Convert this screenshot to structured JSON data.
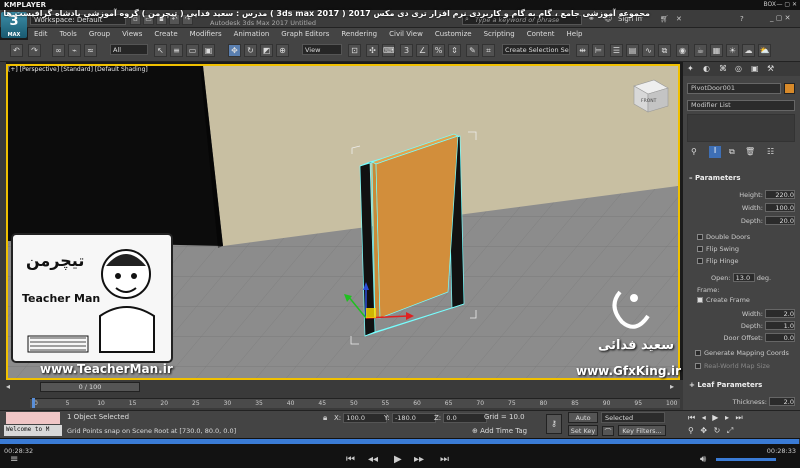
{
  "player": {
    "brand": "KMPLAYER",
    "box_label": "BOX",
    "time_current": "00:28:32",
    "time_total": "00:28:33",
    "progress": 0.999
  },
  "overlay_title": "مجموعه آموزشی جامع ، گام به گام و کاربردی نرم افزار تری دی مکس 2017 ( 3ds max 2017 ) مدرس : سعید فدایی ( تیچرمن ) گروه آموزشی پادشاه گرافیست ها",
  "app": {
    "logo": "3",
    "logo_sub": "MAX",
    "workspace": "Workspace: Default",
    "title": "Autodesk 3ds Max 2017     Untitled",
    "search_placeholder": "Type a keyword or phrase",
    "sign_in": "Sign In"
  },
  "menu": [
    "Edit",
    "Tools",
    "Group",
    "Views",
    "Create",
    "Modifiers",
    "Animation",
    "Graph Editors",
    "Rendering",
    "Civil View",
    "Customize",
    "Scripting",
    "Content",
    "Help"
  ],
  "toolbar": {
    "filter_select": "All",
    "view_select": "View",
    "selection_set": "Create Selection Se"
  },
  "viewport": {
    "label": "[+] [Perspective] [Standard] [Default Shading]",
    "viewcube_label": "FRONT"
  },
  "command_panel": {
    "object_name": "PivotDoor001",
    "modifier_list": "Modifier List",
    "parameters_title": "Parameters",
    "params": [
      {
        "label": "Height:",
        "value": "220.0"
      },
      {
        "label": "Width:",
        "value": "100.0"
      },
      {
        "label": "Depth:",
        "value": "20.0"
      }
    ],
    "checks": [
      "Double Doors",
      "Flip Swing",
      "Flip Hinge"
    ],
    "open_label": "Open:",
    "open_value": "13.0",
    "open_unit": "deg.",
    "frame_label": "Frame:",
    "create_frame": "Create Frame",
    "frame_params": [
      {
        "label": "Width:",
        "value": "2.0"
      },
      {
        "label": "Depth:",
        "value": "1.0"
      },
      {
        "label": "Door Offset:",
        "value": "0.0"
      }
    ],
    "gen_map": "Generate Mapping Coords",
    "real_world": "Real-World Map Size",
    "leaf_title": "Leaf Parameters",
    "thickness_label": "Thickness:",
    "thickness_value": "2.0"
  },
  "timeline": {
    "frame_counter": "0 / 100",
    "ticks": [
      "0",
      "5",
      "10",
      "15",
      "20",
      "25",
      "30",
      "35",
      "40",
      "45",
      "50",
      "55",
      "60",
      "65",
      "70",
      "75",
      "80",
      "85",
      "90",
      "95",
      "100"
    ]
  },
  "status": {
    "welcome": "Welcome to M",
    "selected": "1 Object Selected",
    "snap_info": "Grid Points snap on Scene Root at [730.0, 80.0, 0.0]",
    "x_label": "X:",
    "x_value": "100.0",
    "y_label": "Y:",
    "y_value": "-180.0",
    "z_label": "Z:",
    "z_value": "0.0",
    "grid": "Grid = 10.0",
    "add_time_tag": "Add Time Tag",
    "auto_key": "Auto Key",
    "set_key": "Set Key",
    "selected_dropdown": "Selected",
    "key_filters": "Key Filters..."
  },
  "watermarks": {
    "teacherman_url": "www.TeacherMan.ir",
    "gfx_url": "www.GfxKing.ir",
    "author_fa": "سعید فدائی",
    "logo_fa": "تیچرمن",
    "logo_en": "Teacher Man"
  }
}
